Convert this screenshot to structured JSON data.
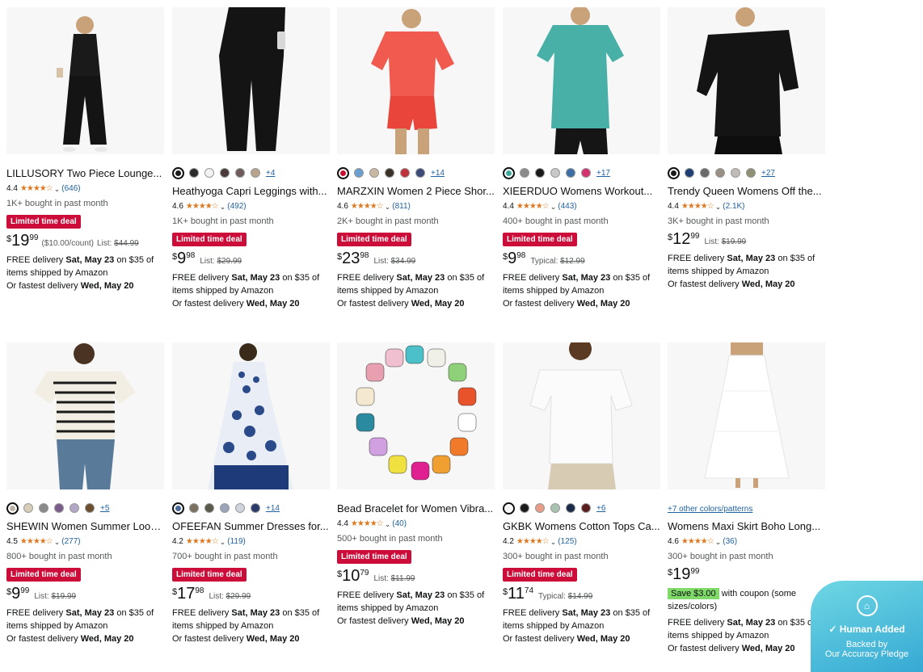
{
  "products": [
    {
      "title": "LILLUSORY Two Piece Lounge...",
      "rating": "4.4",
      "stars": "★★★★☆",
      "reviews": "(646)",
      "bought": "1K+ bought in past month",
      "deal": "Limited time deal",
      "price": {
        "cur": "$",
        "whole": "19",
        "frac": "99"
      },
      "unit_price": "($10.00/count)",
      "list_label": "List:",
      "list_price": "$44.99",
      "delivery_prefix": "FREE delivery ",
      "delivery_date": "Sat, May 23",
      "delivery_suffix": " on $35 of items shipped by Amazon",
      "fastest_prefix": "Or fastest delivery ",
      "fastest_date": "Wed, May 20",
      "colors": []
    },
    {
      "title": "Heathyoga Capri Leggings with...",
      "rating": "4.6",
      "stars": "★★★★☆",
      "reviews": "(492)",
      "bought": "1K+ bought in past month",
      "deal": "Limited time deal",
      "price": {
        "cur": "$",
        "whole": "9",
        "frac": "98"
      },
      "list_label": "List:",
      "list_price": "$29.99",
      "delivery_prefix": "FREE delivery ",
      "delivery_date": "Sat, May 23",
      "delivery_suffix": " on $35 of items shipped by Amazon",
      "fastest_prefix": "Or fastest delivery ",
      "fastest_date": "Wed, May 20",
      "colors": [
        "#1a1a1a",
        "#2b2b2b",
        "#f2f2f2",
        "#4a3a3a",
        "#6e5c5c",
        "#b8a48c"
      ],
      "more_colors": "+4"
    },
    {
      "title": "MARZXIN Women 2 Piece Shor...",
      "rating": "4.6",
      "stars": "★★★★☆",
      "reviews": "(811)",
      "bought": "2K+ bought in past month",
      "deal": "Limited time deal",
      "price": {
        "cur": "$",
        "whole": "23",
        "frac": "98"
      },
      "list_label": "List:",
      "list_price": "$34.99",
      "delivery_prefix": "FREE delivery ",
      "delivery_date": "Sat, May 23",
      "delivery_suffix": " on $35 of items shipped by Amazon",
      "fastest_prefix": "Or fastest delivery ",
      "fastest_date": "Wed, May 20",
      "colors": [
        "#c8102e",
        "#6a9fd0",
        "#c9b8a0",
        "#3a3228",
        "#c0303a",
        "#3c4a7a"
      ],
      "more_colors": "+14"
    },
    {
      "title": "XIEERDUO Womens Workout...",
      "rating": "4.4",
      "stars": "★★★★☆",
      "reviews": "(443)",
      "bought": "400+ bought in past month",
      "deal": "Limited time deal",
      "price": {
        "cur": "$",
        "whole": "9",
        "frac": "98"
      },
      "list_label": "Typical:",
      "list_price": "$12.99",
      "delivery_prefix": "FREE delivery ",
      "delivery_date": "Sat, May 23",
      "delivery_suffix": " on $35 of items shipped by Amazon",
      "fastest_prefix": "Or fastest delivery ",
      "fastest_date": "Wed, May 20",
      "colors": [
        "#3fa89e",
        "#8a8a8a",
        "#1a1a1a",
        "#c8c8c8",
        "#3a6ea5",
        "#d4326e"
      ],
      "more_colors": "+17"
    },
    {
      "title": "Trendy Queen Womens Off the...",
      "rating": "4.4",
      "stars": "★★★★☆",
      "reviews": "(2.1K)",
      "bought": "3K+ bought in past month",
      "price": {
        "cur": "$",
        "whole": "12",
        "frac": "99"
      },
      "list_label": "List:",
      "list_price": "$19.99",
      "delivery_prefix": "FREE delivery ",
      "delivery_date": "Sat, May 23",
      "delivery_suffix": " on $35 of items shipped by Amazon",
      "fastest_prefix": "Or fastest delivery ",
      "fastest_date": "Wed, May 20",
      "colors": [
        "#1a1a1a",
        "#1f3f74",
        "#6a6a6a",
        "#9a8f84",
        "#c0bdb8",
        "#8f8f74"
      ],
      "more_colors": "+27"
    },
    {
      "title": "SHEWIN Women Summer Loos...",
      "rating": "4.5",
      "stars": "★★★★☆",
      "reviews": "(277)",
      "bought": "800+ bought in past month",
      "deal": "Limited time deal",
      "price": {
        "cur": "$",
        "whole": "9",
        "frac": "99"
      },
      "list_label": "List:",
      "list_price": "$19.99",
      "delivery_prefix": "FREE delivery ",
      "delivery_date": "Sat, May 23",
      "delivery_suffix": " on $35 of items shipped by Amazon",
      "fastest_prefix": "Or fastest delivery ",
      "fastest_date": "Wed, May 20",
      "colors": [
        "#bdb3a4",
        "#d8cdb8",
        "#8a8a8a",
        "#7a5c8a",
        "#b2a7c6",
        "#6b4e2e"
      ],
      "more_colors": "+5"
    },
    {
      "title": "OFEEFAN Summer Dresses for...",
      "rating": "4.2",
      "stars": "★★★★☆",
      "reviews": "(119)",
      "bought": "700+ bought in past month",
      "deal": "Limited time deal",
      "price": {
        "cur": "$",
        "whole": "17",
        "frac": "98"
      },
      "list_label": "List:",
      "list_price": "$29.99",
      "delivery_prefix": "FREE delivery ",
      "delivery_date": "Sat, May 23",
      "delivery_suffix": " on $35 of items shipped by Amazon",
      "fastest_prefix": "Or fastest delivery ",
      "fastest_date": "Wed, May 20",
      "colors": [
        "#4a6a9a",
        "#7a7060",
        "#5a5a4a",
        "#9aa4b8",
        "#d0d4dc",
        "#2a3a6a"
      ],
      "more_colors": "+14"
    },
    {
      "title": "Bead Bracelet for Women Vibra...",
      "rating": "4.4",
      "stars": "★★★★☆",
      "reviews": "(40)",
      "bought": "500+ bought in past month",
      "deal": "Limited time deal",
      "price": {
        "cur": "$",
        "whole": "10",
        "frac": "79"
      },
      "list_label": "List:",
      "list_price": "$11.99",
      "delivery_prefix": "FREE delivery ",
      "delivery_date": "Sat, May 23",
      "delivery_suffix": " on $35 of items shipped by Amazon",
      "fastest_prefix": "Or fastest delivery ",
      "fastest_date": "Wed, May 20",
      "colors": []
    },
    {
      "title": "GKBK Womens Cotton Tops Ca...",
      "rating": "4.2",
      "stars": "★★★★☆",
      "reviews": "(125)",
      "bought": "300+ bought in past month",
      "deal": "Limited time deal",
      "price": {
        "cur": "$",
        "whole": "11",
        "frac": "74"
      },
      "list_label": "Typical:",
      "list_price": "$14.99",
      "delivery_prefix": "FREE delivery ",
      "delivery_date": "Sat, May 23",
      "delivery_suffix": " on $35 of items shipped by Amazon",
      "fastest_prefix": "Or fastest delivery ",
      "fastest_date": "Wed, May 20",
      "colors": [
        "#f4f4f4",
        "#1a1a1a",
        "#e89c88",
        "#a8c4b0",
        "#1c2a4a",
        "#5a1e1e"
      ],
      "more_colors": "+6"
    },
    {
      "title": "Womens Maxi Skirt Boho Long...",
      "rating": "4.6",
      "stars": "★★★★☆",
      "reviews": "(36)",
      "bought": "300+ bought in past month",
      "price": {
        "cur": "$",
        "whole": "19",
        "frac": "99"
      },
      "coupon": "Save $3.00",
      "coupon_suffix": " with coupon (some sizes/colors)",
      "delivery_prefix": "FREE delivery ",
      "delivery_date": "Sat, May 23",
      "delivery_suffix": " on $35 of items shipped by Amazon",
      "fastest_prefix": "Or fastest delivery ",
      "fastest_date": "Wed, May 20",
      "colors": [],
      "more_link": "+7 other colors/patterns"
    }
  ],
  "badge": {
    "line1": "Human Added",
    "line2": "Backed by",
    "line3": "Our Accuracy Pledge"
  }
}
